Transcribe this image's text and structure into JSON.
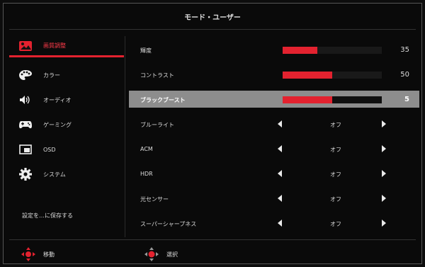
{
  "title": "モード・ユーザー",
  "sidebar": {
    "items": [
      {
        "label": "画質調整",
        "icon": "picture-icon",
        "active": true
      },
      {
        "label": "カラー",
        "icon": "palette-icon",
        "active": false
      },
      {
        "label": "オーディオ",
        "icon": "speaker-icon",
        "active": false
      },
      {
        "label": "ゲーミング",
        "icon": "gamepad-icon",
        "active": false
      },
      {
        "label": "OSD",
        "icon": "osd-icon",
        "active": false
      },
      {
        "label": "システム",
        "icon": "gear-icon",
        "active": false
      }
    ],
    "save_label": "設定を…に保存する"
  },
  "settings": {
    "brightness": {
      "label": "輝度",
      "value": "35",
      "level": 0.35
    },
    "contrast": {
      "label": "コントラスト",
      "value": "50",
      "level": 0.5
    },
    "black_boost": {
      "label": "ブラックブースト",
      "value": "5",
      "level": 0.5
    },
    "blue_light": {
      "label": "ブルーライト",
      "value": "オフ"
    },
    "acm": {
      "label": "ACM",
      "value": "オフ"
    },
    "hdr": {
      "label": "HDR",
      "value": "オフ"
    },
    "light_sensor": {
      "label": "光センサー",
      "value": "オフ"
    },
    "super_sharpness": {
      "label": "スーパーシャープネス",
      "value": "オフ"
    }
  },
  "hints": {
    "move": "移動",
    "select": "選択"
  },
  "colors": {
    "accent": "#e3222f",
    "highlight": "#8d8d8d"
  }
}
